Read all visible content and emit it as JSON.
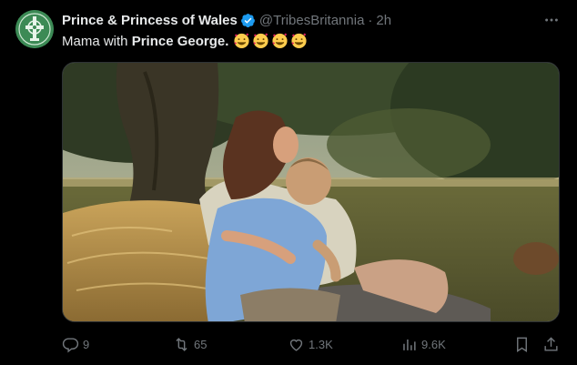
{
  "tweet": {
    "display_name": "Prince & Princess of Wales",
    "handle": "@TribesBritannia",
    "separator": "·",
    "time": "2h",
    "text_prefix": "Mama with ",
    "text_bold": "Prince George.",
    "emojis": [
      "smiling-face-with-hearts",
      "smiling-face-with-hearts",
      "smiling-face-with-hearts",
      "smiling-face-with-hearts"
    ],
    "media_alt_icon": "photo-mother-and-son-hugging-on-hay-bale"
  },
  "actions": {
    "replies": "9",
    "reposts": "65",
    "likes": "1.3K",
    "views": "9.6K"
  },
  "colors": {
    "background": "#000000",
    "text": "#e7e9ea",
    "muted": "#71767b",
    "verified": "#1d9bf0",
    "avatar": "#3c8a55"
  }
}
